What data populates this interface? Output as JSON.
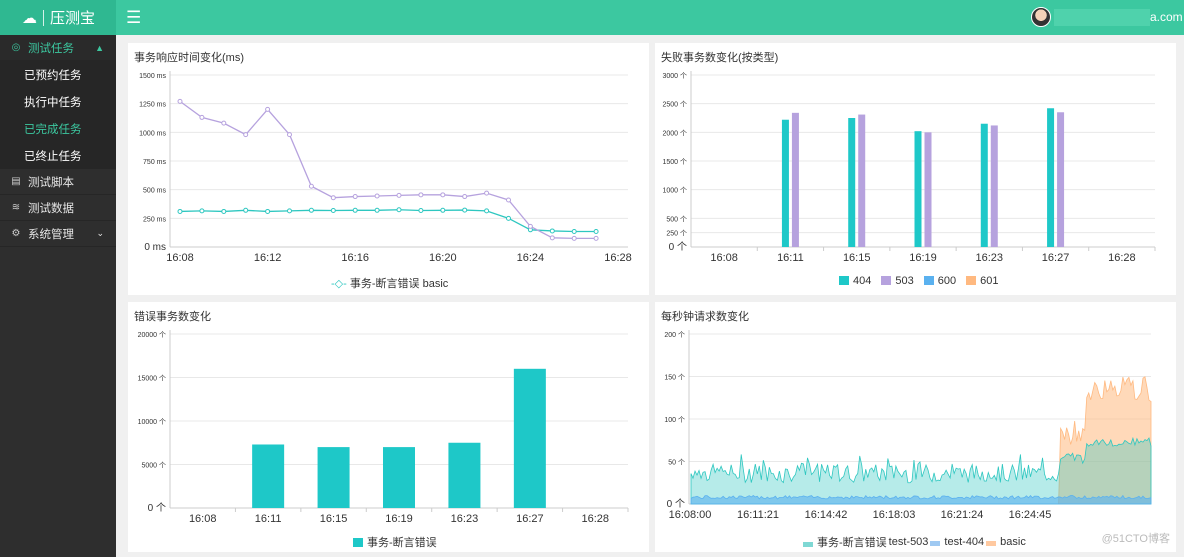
{
  "app": {
    "logo_text": "压测宝",
    "user_email_suffix": "a.com",
    "accent": "#3cc8a0"
  },
  "sidebar": {
    "sections": [
      {
        "label": "测试任务",
        "icon": "target-icon",
        "expanded": true
      },
      {
        "label": "测试脚本",
        "icon": "script-icon"
      },
      {
        "label": "测试数据",
        "icon": "database-icon"
      },
      {
        "label": "系统管理",
        "icon": "gear-icon"
      }
    ],
    "sub_items": [
      "已预约任务",
      "执行中任务",
      "已完成任务",
      "已终止任务"
    ]
  },
  "panels": {
    "response_time": {
      "title": "事务响应时间变化(ms)"
    },
    "failed_tx": {
      "title": "失败事务数变化(按类型)"
    },
    "error_tx": {
      "title": "错误事务数变化"
    },
    "rps": {
      "title": "每秒钟请求数变化"
    }
  },
  "watermark": "@51CTO博客",
  "chart_data": [
    {
      "type": "line",
      "title": "事务响应时间变化(ms)",
      "x_ticks": [
        "16:08",
        "16:12",
        "16:16",
        "16:20",
        "16:24",
        "16:28"
      ],
      "y_ticks": [
        "0 ms",
        "250 ms",
        "500 ms",
        "750 ms",
        "1000 ms",
        "1250 ms",
        "1500 ms"
      ],
      "ylim": [
        0,
        1500
      ],
      "x_range": [
        0,
        20
      ],
      "series": [
        {
          "name": "事务-断言错误",
          "color": "#2ec7c0",
          "x": [
            0,
            1,
            2,
            3,
            4,
            5,
            6,
            7,
            8,
            9,
            10,
            11,
            12,
            13,
            14,
            15,
            16,
            17,
            18,
            19
          ],
          "values": [
            310,
            315,
            310,
            320,
            310,
            315,
            320,
            318,
            320,
            320,
            325,
            318,
            320,
            322,
            315,
            250,
            150,
            140,
            135,
            135
          ]
        },
        {
          "name": "basic",
          "color": "#b6a2de",
          "x": [
            0,
            1,
            2,
            3,
            4,
            5,
            6,
            7,
            8,
            9,
            10,
            11,
            12,
            13,
            14,
            15,
            16,
            17,
            18,
            19
          ],
          "values": [
            1270,
            1130,
            1080,
            980,
            1200,
            980,
            530,
            430,
            440,
            445,
            450,
            455,
            455,
            440,
            470,
            410,
            180,
            80,
            75,
            75
          ]
        }
      ],
      "legend": [
        "事务-断言错误 basic"
      ]
    },
    {
      "type": "bar",
      "title": "失败事务数变化(按类型)",
      "categories": [
        "16:08",
        "16:11",
        "16:15",
        "16:19",
        "16:23",
        "16:27",
        "16:28"
      ],
      "y_ticks": [
        "0 个",
        "250 个",
        "500 个",
        "1000 个",
        "1500 个",
        "2000 个",
        "2500 个",
        "3000 个"
      ],
      "ylim": [
        0,
        3000
      ],
      "series": [
        {
          "name": "404",
          "color": "#1ec8c8",
          "values": [
            0,
            2220,
            2250,
            2020,
            2150,
            2420,
            0
          ]
        },
        {
          "name": "503",
          "color": "#b6a2de",
          "values": [
            0,
            2340,
            2310,
            2000,
            2120,
            2350,
            0
          ]
        },
        {
          "name": "600",
          "color": "#5ab1ef",
          "values": [
            0,
            0,
            0,
            0,
            0,
            0,
            0
          ]
        },
        {
          "name": "601",
          "color": "#ffb980",
          "values": [
            0,
            0,
            0,
            0,
            0,
            0,
            0
          ]
        }
      ]
    },
    {
      "type": "bar",
      "title": "错误事务数变化",
      "categories": [
        "16:08",
        "16:11",
        "16:15",
        "16:19",
        "16:23",
        "16:27",
        "16:28"
      ],
      "y_ticks": [
        "0 个",
        "5000 个",
        "10000 个",
        "15000 个",
        "20000 个"
      ],
      "ylim": [
        0,
        20000
      ],
      "series": [
        {
          "name": "事务-断言错误",
          "color": "#1ec8c8",
          "values": [
            0,
            7300,
            7000,
            7000,
            7500,
            16000,
            0
          ]
        }
      ]
    },
    {
      "type": "area",
      "title": "每秒钟请求数变化",
      "x_ticks": [
        "16:08:00",
        "16:11:21",
        "16:14:42",
        "16:18:03",
        "16:21:24",
        "16:24:45"
      ],
      "y_ticks": [
        "0 个",
        "50 个",
        "100 个",
        "150 个",
        "200 个"
      ],
      "ylim": [
        0,
        200
      ],
      "series": [
        {
          "name": "事务-断言错误",
          "color": "#2ec7c0"
        },
        {
          "name": "test-503",
          "color": "#b6a2de"
        },
        {
          "name": "test-404",
          "color": "#5ab1ef"
        },
        {
          "name": "basic",
          "color": "#ffb980"
        }
      ]
    }
  ]
}
